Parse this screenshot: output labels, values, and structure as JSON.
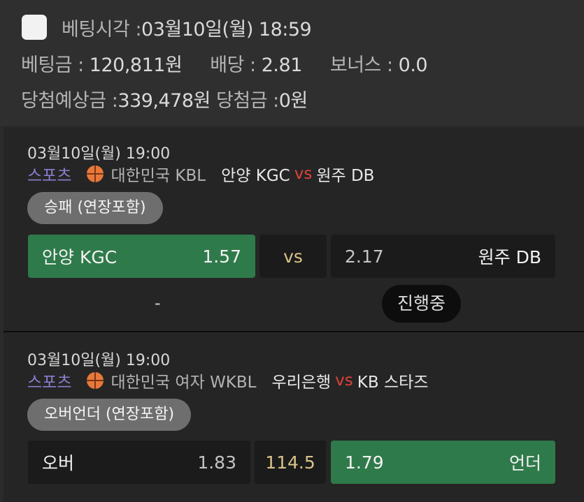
{
  "summary": {
    "bet_time_label": "베팅시각 :",
    "bet_time_value": "03월10일(월) 18:59",
    "bet_amount_label": "베팅금 :",
    "bet_amount_value": "120,811원",
    "odds_label": "배당 :",
    "odds_value": "2.81",
    "bonus_label": "보너스 :",
    "bonus_value": "0.0",
    "expected_label": "당첨예상금 :",
    "expected_value": "339,478원",
    "win_label": "당첨금 :",
    "win_value": "0원"
  },
  "matches": [
    {
      "date": "03월10일(월) 19:00",
      "sport": "스포츠",
      "sport_icon": "basketball-icon",
      "league": "대한민국 KBL",
      "home": "안양 KGC",
      "vs": "vs",
      "away": "원주 DB",
      "market": "승패 (연장포함)",
      "left_name": "안양 KGC",
      "left_odd": "1.57",
      "mid": "vs",
      "right_odd": "2.17",
      "right_name": "원주 DB",
      "result": "-",
      "status": "진행중"
    },
    {
      "date": "03월10일(월) 19:00",
      "sport": "스포츠",
      "sport_icon": "basketball-icon",
      "league": "대한민국 여자 WKBL",
      "home": "우리은행",
      "vs": "vs",
      "away": "KB 스타즈",
      "market": "오버언더 (연장포함)",
      "left_name": "오버",
      "left_odd": "1.83",
      "mid": "114.5",
      "right_odd": "1.79",
      "right_name": "언더"
    }
  ],
  "colors": {
    "selected_green": "#2f7a4a",
    "vs_red": "#e0413a",
    "sport_purple": "#8a7fd0",
    "line_gold": "#d8c488"
  }
}
